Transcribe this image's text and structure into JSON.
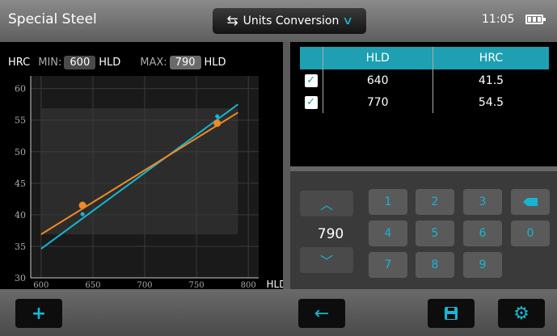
{
  "header": {
    "title": "Special Steel",
    "units_label": "Units Conversion",
    "time": "11:05"
  },
  "range": {
    "y_unit": "HRC",
    "min_label": "MIN:",
    "min_value": "600",
    "min_unit": "HLD",
    "max_label": "MAX:",
    "max_value": "790",
    "max_unit": "HLD"
  },
  "chart_data": {
    "type": "line",
    "xlabel": "HLD",
    "ylabel": "HRC",
    "xlim": [
      590,
      810
    ],
    "ylim": [
      30,
      62
    ],
    "x_ticks": [
      "600",
      "650",
      "700",
      "750",
      "800"
    ],
    "y_ticks": [
      "30",
      "35",
      "40",
      "45",
      "50",
      "55",
      "60"
    ],
    "selected_range": [
      600,
      790
    ],
    "series": [
      {
        "color": "#19b5d0",
        "x": [
          600,
          790
        ],
        "y": [
          34.6,
          57.5
        ]
      },
      {
        "color": "#f08a24",
        "x": [
          600,
          790
        ],
        "y": [
          36.9,
          56.2
        ]
      }
    ],
    "points": [
      {
        "x": 640,
        "y": 41.5,
        "color": "#f08a24"
      },
      {
        "x": 770,
        "y": 54.5,
        "color": "#f08a24"
      },
      {
        "x": 640,
        "y": 40.1,
        "color": "#19b5d0"
      },
      {
        "x": 770,
        "y": 55.6,
        "color": "#19b5d0"
      }
    ]
  },
  "table": {
    "headers": [
      "HLD",
      "HRC"
    ],
    "rows": [
      {
        "checked": "✓",
        "hld": "640",
        "hrc": "41.5"
      },
      {
        "checked": "✓",
        "hld": "770",
        "hrc": "54.5"
      }
    ]
  },
  "keypad": {
    "value": "790",
    "keys": [
      "1",
      "2",
      "3",
      "4",
      "5",
      "6",
      "7",
      "8",
      "9",
      "0"
    ]
  },
  "icons": {
    "add": "plus-icon",
    "back": "left-arrow-icon",
    "save": "floppy-disk-icon",
    "settings": "gear-icon",
    "backspace": "backspace-icon"
  },
  "colors": {
    "accent": "#19b5d0",
    "orange": "#f08a24",
    "header_blue": "#1e9fb2"
  }
}
